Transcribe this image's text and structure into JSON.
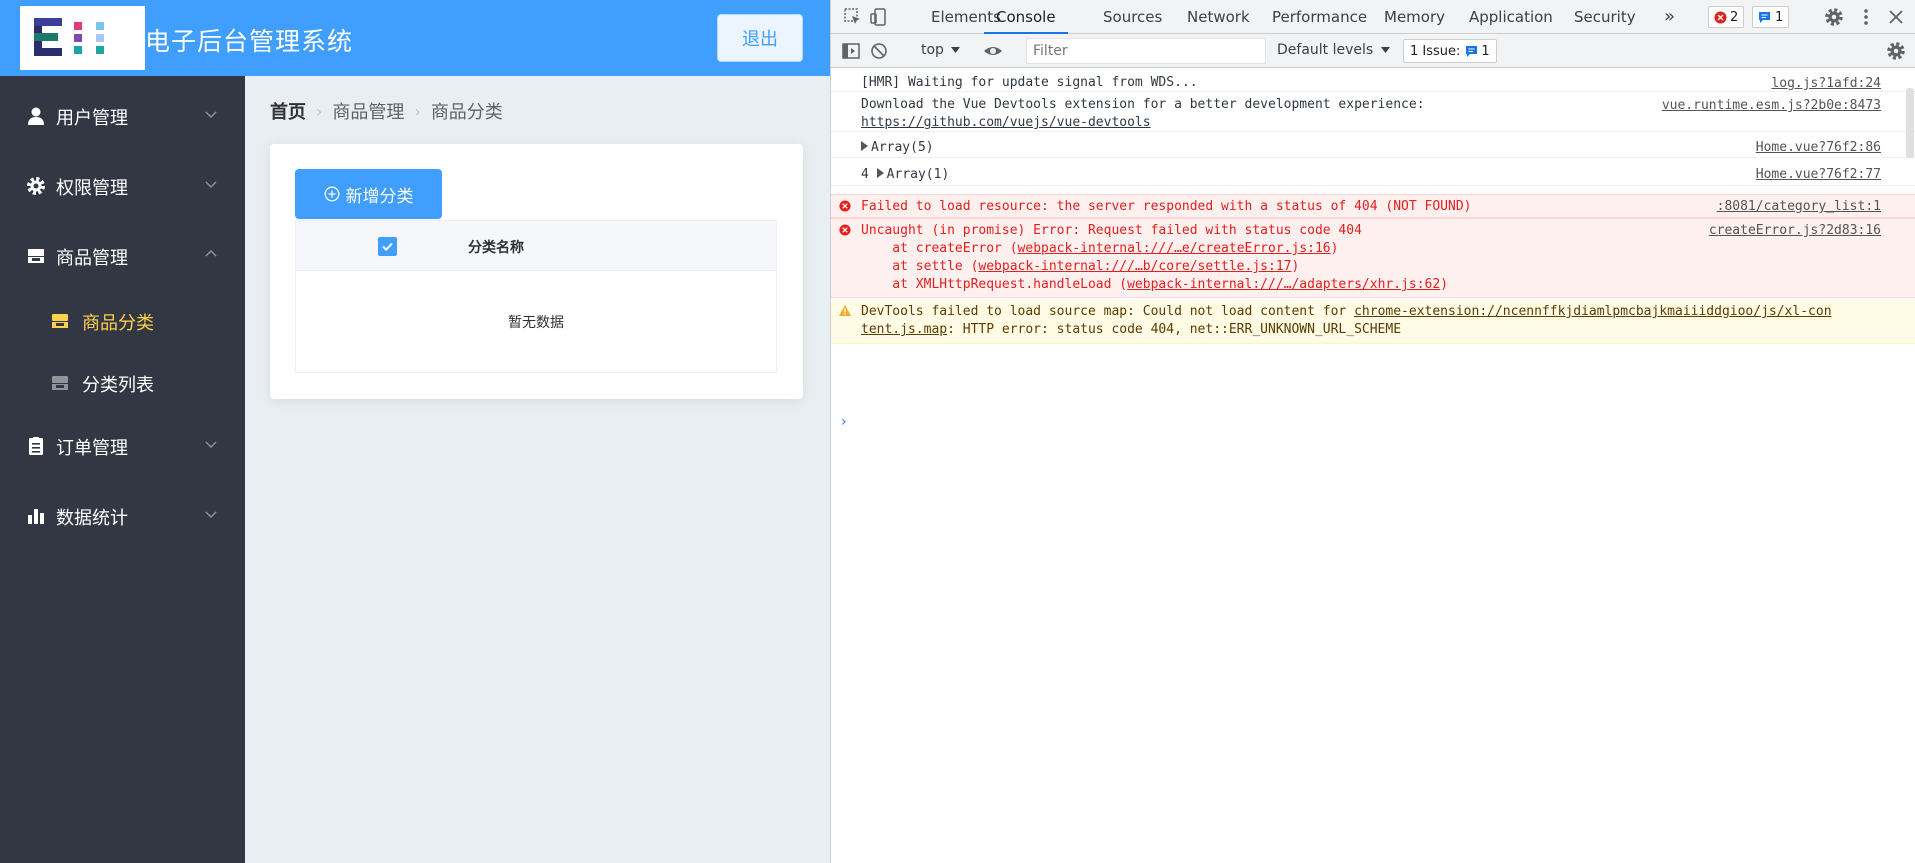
{
  "app": {
    "title": "电子后台管理系统",
    "logout_label": "退出",
    "logo_letters": "E",
    "menu": [
      {
        "label": "用户管理",
        "icon": "user-icon",
        "expanded": false
      },
      {
        "label": "权限管理",
        "icon": "gear-icon",
        "expanded": false
      },
      {
        "label": "商品管理",
        "icon": "goods-icon",
        "expanded": true
      },
      {
        "label": "商品分类",
        "icon": "shop-icon",
        "active": true
      },
      {
        "label": "分类列表",
        "icon": "shop-icon",
        "active": false
      },
      {
        "label": "订单管理",
        "icon": "order-icon",
        "expanded": false
      },
      {
        "label": "数据统计",
        "icon": "chart-icon",
        "expanded": false
      }
    ],
    "breadcrumb": [
      "首页",
      "商品管理",
      "商品分类"
    ],
    "add_button_label": "新增分类",
    "table": {
      "column_header": "分类名称",
      "header_checked": true,
      "empty_text": "暂无数据"
    },
    "colors": {
      "primary": "#409eff",
      "sidebar": "#333744",
      "active": "#ffd04b"
    }
  },
  "devtools": {
    "tabs": [
      "Elements",
      "Console",
      "Sources",
      "Network",
      "Performance",
      "Memory",
      "Application",
      "Security"
    ],
    "active_tab": "Console",
    "more_tabs": "»",
    "error_count": "2",
    "message_count": "1",
    "context": "top",
    "filter_placeholder": "Filter",
    "levels": "Default levels",
    "issues_label": "1 Issue:",
    "issues_count": "1",
    "messages": [
      {
        "text": "[HMR] Waiting for update signal from WDS...",
        "source": "log.js?1afd:24"
      },
      {
        "text": "Download the Vue Devtools extension for a better development experience:",
        "link": "https://github.com/vuejs/vue-devtools",
        "source": "vue.runtime.esm.js?2b0e:8473"
      },
      {
        "text": "Array(5)",
        "source": "Home.vue?76f2:86"
      },
      {
        "prefix": "4",
        "text": "Array(1)",
        "source": "Home.vue?76f2:77"
      },
      {
        "text": "Failed to load resource: the server responded with a status of 404 (NOT FOUND)",
        "source": ":8081/category_list:1"
      },
      {
        "text": "Uncaught (in promise) Error: Request failed with status code 404",
        "source": "createError.js?2d83:16",
        "stack": [
          {
            "fn": "    at createError (",
            "loc": "webpack-internal:///…e/createError.js:16",
            "end": ")"
          },
          {
            "fn": "    at settle (",
            "loc": "webpack-internal:///…b/core/settle.js:17",
            "end": ")"
          },
          {
            "fn": "    at XMLHttpRequest.handleLoad (",
            "loc": "webpack-internal:///…/adapters/xhr.js:62",
            "end": ")"
          }
        ]
      },
      {
        "text": "DevTools failed to load source map: Could not load content for ",
        "link": "chrome-extension://ncennffkjdiamlpmcbajkmaiiiddgioo/js/xl-con",
        "link2": "tent.js.map",
        "text2": ": HTTP error: status code 404, net::ERR_UNKNOWN_URL_SCHEME"
      }
    ],
    "colors": {
      "error": "#e4201d",
      "accent": "#1a73e8"
    }
  }
}
